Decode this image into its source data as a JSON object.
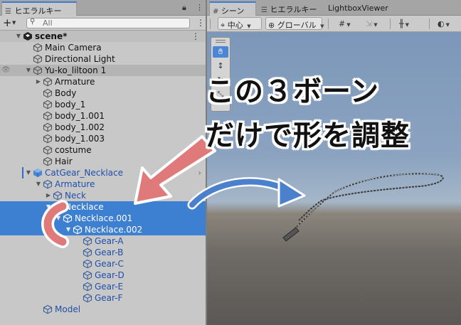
{
  "hierarchy": {
    "tab_label": "ヒエラルキー",
    "search_placeholder": "All",
    "rows": [
      {
        "label": "scene*",
        "depth": 0,
        "arrow": "down",
        "icon": "unity-scene",
        "style": "scene"
      },
      {
        "label": "Main Camera",
        "depth": 1,
        "arrow": "",
        "icon": "gameobject",
        "style": ""
      },
      {
        "label": "Directional Light",
        "depth": 1,
        "arrow": "",
        "icon": "gameobject",
        "style": ""
      },
      {
        "label": "Yu-ko_liltoon 1",
        "depth": 1,
        "arrow": "down",
        "icon": "gameobject",
        "style": "yuko"
      },
      {
        "label": "Armature",
        "depth": 2,
        "arrow": "right",
        "icon": "gameobject",
        "style": ""
      },
      {
        "label": "Body",
        "depth": 2,
        "arrow": "",
        "icon": "gameobject",
        "style": ""
      },
      {
        "label": "body_1",
        "depth": 2,
        "arrow": "",
        "icon": "gameobject",
        "style": ""
      },
      {
        "label": "body_1.001",
        "depth": 2,
        "arrow": "",
        "icon": "gameobject",
        "style": ""
      },
      {
        "label": "body_1.002",
        "depth": 2,
        "arrow": "",
        "icon": "gameobject",
        "style": ""
      },
      {
        "label": "body_1.003",
        "depth": 2,
        "arrow": "",
        "icon": "gameobject",
        "style": ""
      },
      {
        "label": "costume",
        "depth": 2,
        "arrow": "",
        "icon": "gameobject",
        "style": ""
      },
      {
        "label": "Hair",
        "depth": 2,
        "arrow": "",
        "icon": "gameobject",
        "style": ""
      },
      {
        "label": "CatGear_Necklace",
        "depth": 1,
        "arrow": "down",
        "icon": "prefab",
        "style": "blue prefab"
      },
      {
        "label": "Armature",
        "depth": 2,
        "arrow": "down",
        "icon": "gameobject",
        "style": "blue"
      },
      {
        "label": "Neck",
        "depth": 3,
        "arrow": "right",
        "icon": "gameobject",
        "style": "blue"
      },
      {
        "label": "Necklace",
        "depth": 3,
        "arrow": "down",
        "icon": "gameobject",
        "style": "sel"
      },
      {
        "label": "Necklace.001",
        "depth": 4,
        "arrow": "down",
        "icon": "gameobject",
        "style": "sel"
      },
      {
        "label": "Necklace.002",
        "depth": 5,
        "arrow": "down",
        "icon": "gameobject",
        "style": "sel"
      },
      {
        "label": "Gear-A",
        "depth": 6,
        "arrow": "",
        "icon": "gameobject",
        "style": "blue"
      },
      {
        "label": "Gear-B",
        "depth": 6,
        "arrow": "",
        "icon": "gameobject",
        "style": "blue"
      },
      {
        "label": "Gear-C",
        "depth": 6,
        "arrow": "",
        "icon": "gameobject",
        "style": "blue"
      },
      {
        "label": "Gear-D",
        "depth": 6,
        "arrow": "",
        "icon": "gameobject",
        "style": "blue"
      },
      {
        "label": "Gear-E",
        "depth": 6,
        "arrow": "",
        "icon": "gameobject",
        "style": "blue"
      },
      {
        "label": "Gear-F",
        "depth": 6,
        "arrow": "",
        "icon": "gameobject",
        "style": "blue"
      },
      {
        "label": "Model",
        "depth": 2,
        "arrow": "",
        "icon": "gameobject",
        "style": "blue"
      }
    ]
  },
  "scene_panel": {
    "tabs": [
      "シーン",
      "ヒエラルキー",
      "LightboxViewer"
    ],
    "pivot_label": "中心",
    "space_label": "グローバル"
  },
  "annotation": {
    "line1": "この３ボーン",
    "line2": "だけで形を調整",
    "color": "#e07a7a"
  }
}
